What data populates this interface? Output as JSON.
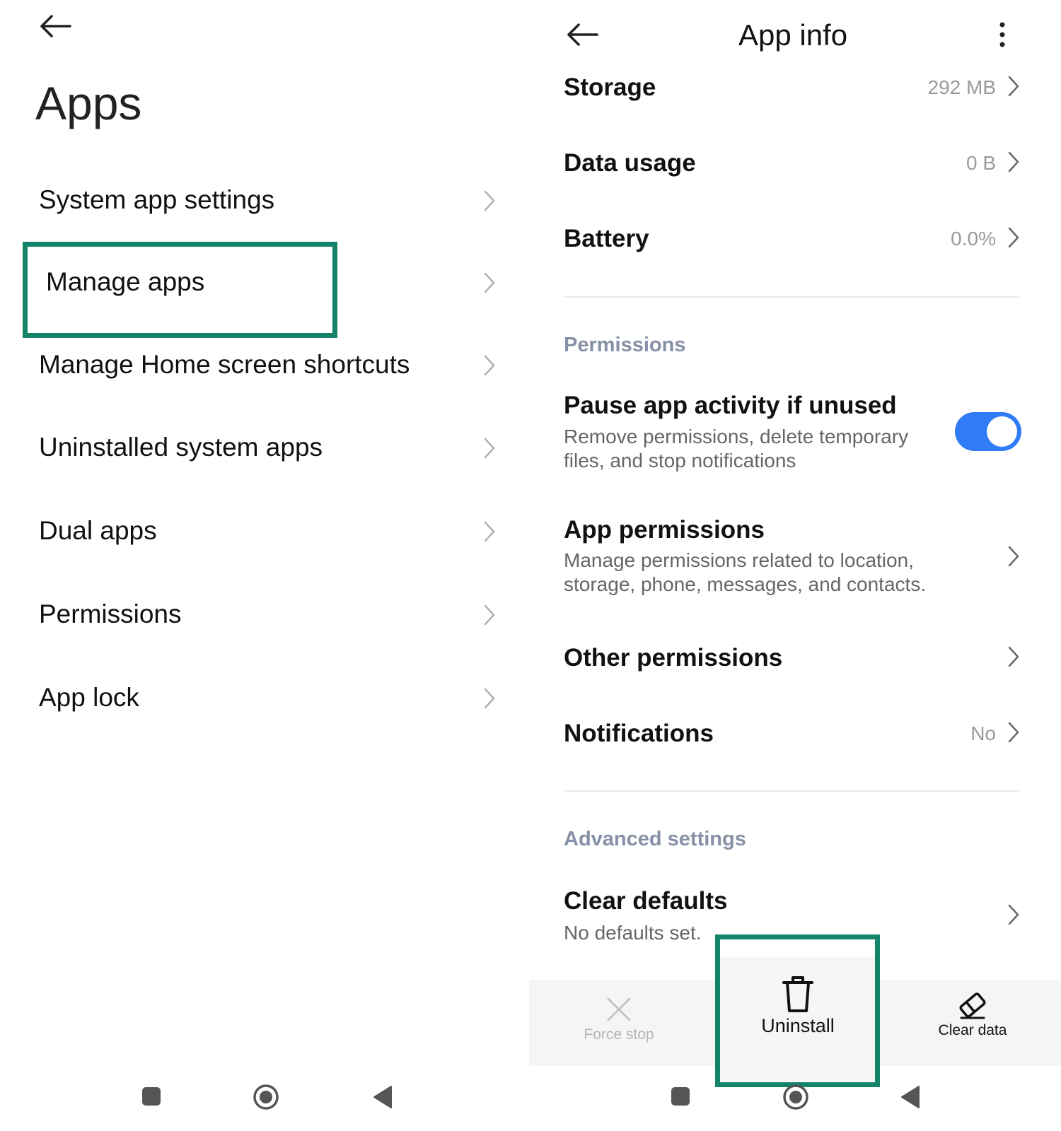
{
  "left_panel": {
    "title": "Apps",
    "items": [
      {
        "label": "System app settings"
      },
      {
        "label": "Manage apps"
      },
      {
        "label": "Manage Home screen shortcuts"
      },
      {
        "label": "Uninstalled system apps"
      },
      {
        "label": "Dual apps"
      },
      {
        "label": "Permissions"
      },
      {
        "label": "App lock"
      }
    ]
  },
  "right_panel": {
    "title": "App info",
    "rows": [
      {
        "label": "Storage",
        "value": "292 MB"
      },
      {
        "label": "Data usage",
        "value": "0 B"
      },
      {
        "label": "Battery",
        "value": "0.0%"
      }
    ],
    "permissions_section": {
      "heading": "Permissions",
      "pause_app": {
        "title": "Pause app activity if unused",
        "subtitle_line1": "Remove permissions, delete temporary",
        "subtitle_line2": "files, and stop notifications",
        "enabled": true
      },
      "app_permissions": {
        "title": "App permissions",
        "subtitle_line1": "Manage permissions related to location,",
        "subtitle_line2": "storage, phone, messages, and contacts."
      },
      "other_permissions": {
        "title": "Other permissions"
      },
      "notifications": {
        "title": "Notifications",
        "value": "No"
      }
    },
    "advanced_section": {
      "heading": "Advanced settings",
      "clear_defaults": {
        "title": "Clear defaults",
        "subtitle": "No defaults set."
      }
    },
    "bottom_actions": {
      "force_stop": "Force stop",
      "uninstall": "Uninstall",
      "clear_data": "Clear data"
    }
  },
  "colors": {
    "highlight": "#138469",
    "toggle_on": "#2f7cf6",
    "section_heading": "#8790a6"
  },
  "icons": [
    "back-arrow-icon",
    "chevron-right-icon",
    "more-vert-icon",
    "close-icon",
    "trash-icon",
    "eraser-icon",
    "square-nav-icon",
    "home-nav-icon",
    "back-triangle-icon"
  ]
}
